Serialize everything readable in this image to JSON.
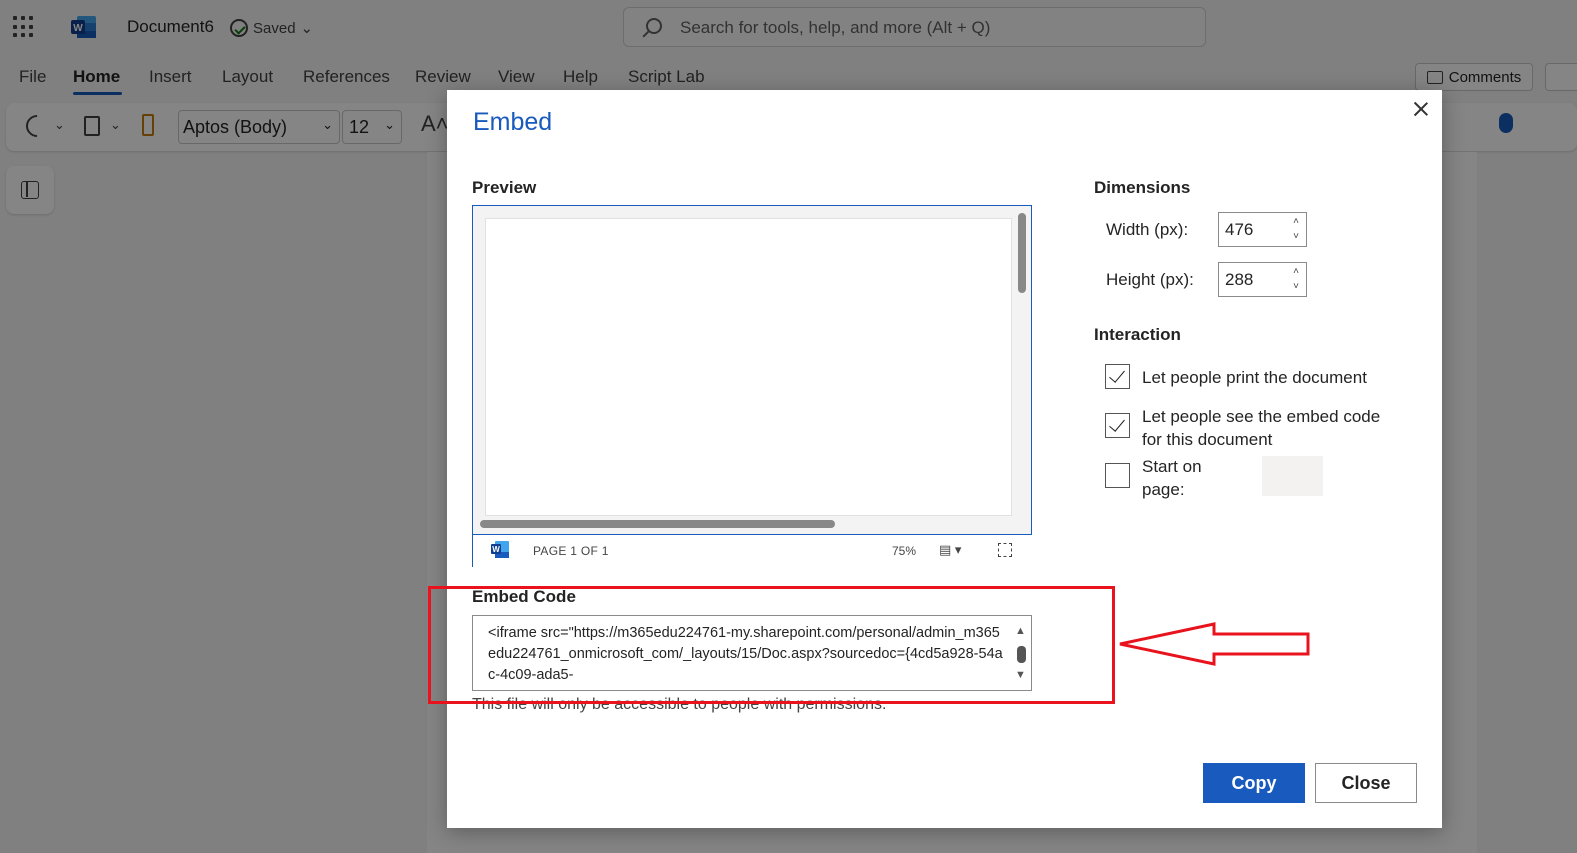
{
  "app": {
    "document_title": "Document6",
    "saved_status": "Saved",
    "search_placeholder": "Search for tools, help, and more (Alt + Q)"
  },
  "menu": {
    "items": [
      "File",
      "Home",
      "Insert",
      "Layout",
      "References",
      "Review",
      "View",
      "Help",
      "Script Lab"
    ],
    "active": "Home",
    "comments_label": "Comments"
  },
  "ribbon": {
    "font_name": "Aptos (Body)",
    "font_size": "12"
  },
  "dialog": {
    "title": "Embed",
    "preview_label": "Preview",
    "preview_page_indicator": "PAGE 1 OF 1",
    "preview_zoom": "75%",
    "dimensions_label": "Dimensions",
    "width_label": "Width (px):",
    "width_value": "476",
    "height_label": "Height (px):",
    "height_value": "288",
    "interaction_label": "Interaction",
    "options": [
      {
        "label": "Let people print the document",
        "checked": true
      },
      {
        "label": "Let people see the embed code for this document",
        "checked": true
      },
      {
        "label": "Start on page:",
        "checked": false
      }
    ],
    "embed_code_label": "Embed Code",
    "embed_code": "<iframe src=\"https://m365edu224761-my.sharepoint.com/personal/admin_m365edu224761_onmicrosoft_com/_layouts/15/Doc.aspx?sourcedoc={4cd5a928-54ac-4c09-ada5-",
    "permission_note": "This file will only be accessible to people with permissions.",
    "copy_button": "Copy",
    "close_button": "Close"
  },
  "colors": {
    "accent": "#185abd",
    "annotation": "#e8131c"
  }
}
